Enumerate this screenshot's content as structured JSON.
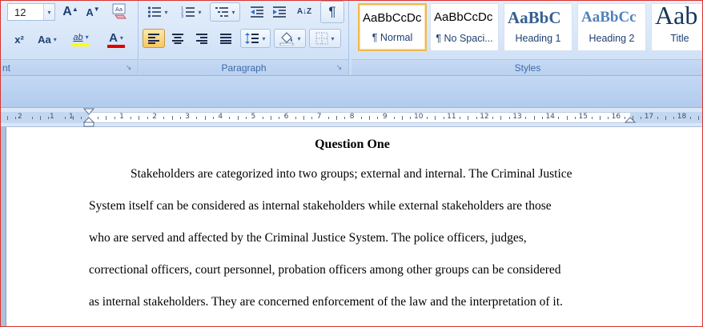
{
  "ribbon": {
    "font": {
      "size_value": "12",
      "group_label_fragment": "nt",
      "grow_glyph": "A",
      "shrink_glyph": "A",
      "clear_glyph": "Aa",
      "superscript_glyph": "x²",
      "change_case_glyph": "Aa",
      "highlight_glyph": "ab",
      "font_color_glyph": "A"
    },
    "paragraph": {
      "label": "Paragraph",
      "sort_glyph": "A↓Z",
      "pilcrow_glyph": "¶"
    },
    "styles": {
      "label": "Styles",
      "tiles": [
        {
          "sample": "AaBbCcDc",
          "name": "¶ Normal",
          "selected": true
        },
        {
          "sample": "AaBbCcDc",
          "name": "¶ No Spaci...",
          "selected": false
        },
        {
          "sample": "AaBbC",
          "name": "Heading 1",
          "selected": false
        },
        {
          "sample": "AaBbCc",
          "name": "Heading 2",
          "selected": false
        },
        {
          "sample": "Aab",
          "name": "Title",
          "selected": false
        }
      ]
    },
    "launcher_glyph": "↘",
    "dropdown_glyph": "▾"
  },
  "ruler": {
    "left_numbers": [
      "2",
      "1",
      "1"
    ],
    "right_numbers": [
      "1",
      "2",
      "3",
      "4",
      "5",
      "6",
      "7",
      "8",
      "9",
      "10",
      "11",
      "12",
      "13",
      "14",
      "15",
      "16",
      "17",
      "18"
    ]
  },
  "document": {
    "title": "Question One",
    "lines": [
      "Stakeholders are categorized into two groups; external and internal.   The Criminal Justice",
      "System itself can be considered as internal stakeholders while external stakeholders are those",
      "who are served and affected by the Criminal Justice System.   The police officers, judges,",
      "correctional officers, court personnel, probation officers among other groups can be considered",
      "as internal stakeholders. They are concerned enforcement of the law and the interpretation of it."
    ]
  },
  "colors": {
    "accent_border": "#d9332e",
    "highlight_yellow": "#ffff00",
    "font_red": "#e00000",
    "ribbon_text": "#15428b"
  }
}
